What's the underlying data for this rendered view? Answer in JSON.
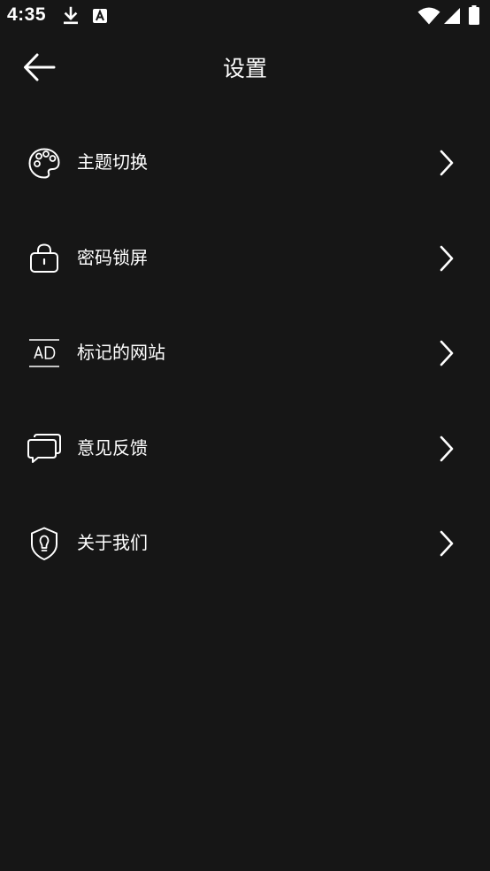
{
  "status_bar": {
    "time": "4:35",
    "icons": [
      "download-icon",
      "text-a-icon",
      "wifi-icon",
      "signal-icon",
      "battery-icon"
    ]
  },
  "header": {
    "title": "设置",
    "back_icon": "back-arrow-icon"
  },
  "menu": {
    "items": [
      {
        "label": "主题切换",
        "icon": "palette-icon"
      },
      {
        "label": "密码锁屏",
        "icon": "lock-icon"
      },
      {
        "label": "标记的网站",
        "icon": "ad-mark-icon"
      },
      {
        "label": "意见反馈",
        "icon": "feedback-icon"
      },
      {
        "label": "关于我们",
        "icon": "about-bulb-icon"
      }
    ]
  },
  "colors": {
    "background": "#161616",
    "foreground": "#ffffff"
  }
}
